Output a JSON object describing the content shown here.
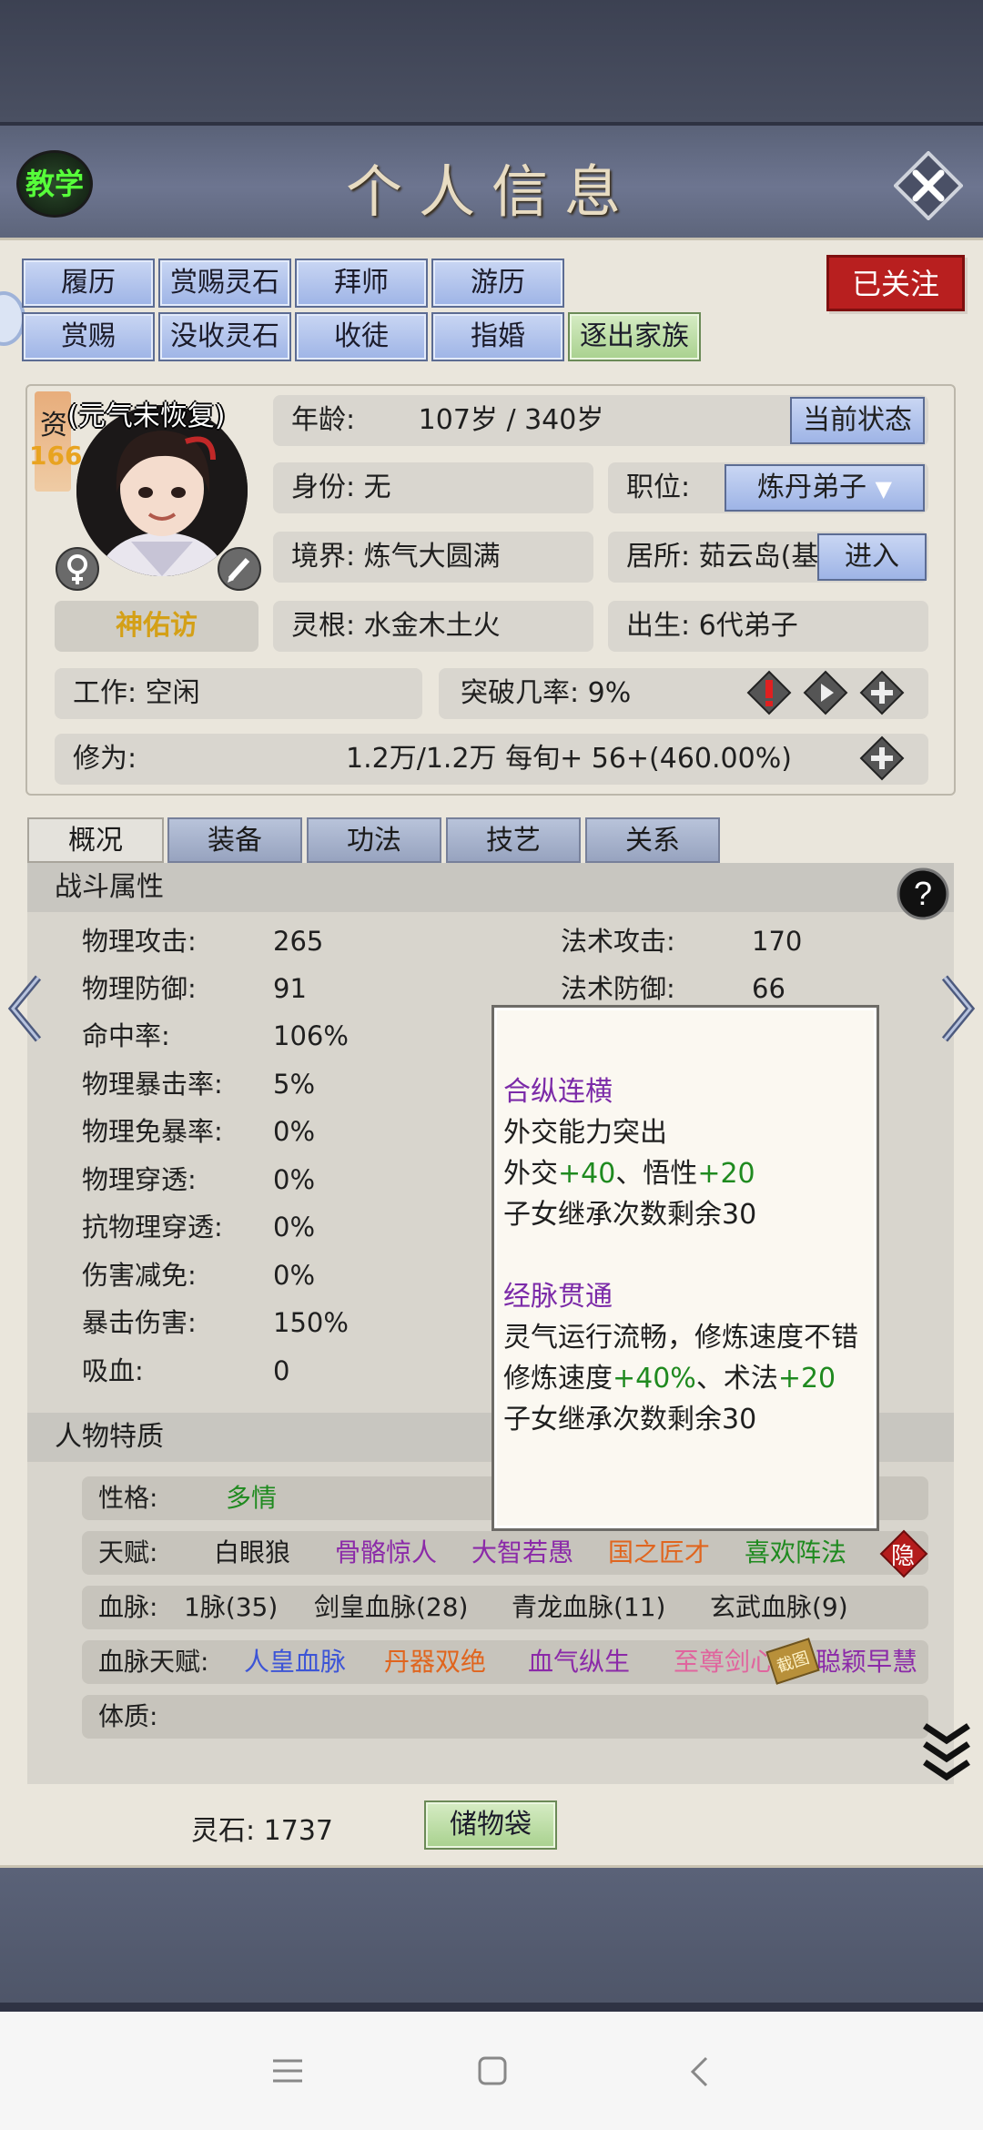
{
  "header": {
    "title": "个人信息",
    "teach_label": "教学"
  },
  "action_rows": [
    [
      "履历",
      "赏赐灵石",
      "拜师",
      "游历"
    ],
    [
      "赏赐",
      "没收灵石",
      "收徒",
      "指婚",
      "逐出家族"
    ]
  ],
  "follow_label": "已关注",
  "profile": {
    "aptitude_label": "资",
    "aptitude_value": "166",
    "status_note": "(元气未恢复)",
    "name": "神佑访",
    "age_label": "年龄:",
    "age_value": "107岁 / 340岁",
    "current_state_btn": "当前状态",
    "identity": "身份:   无",
    "position_label": "职位:",
    "position_value": "炼丹弟子",
    "realm": "境界:   炼气大圆满",
    "residence": "居所: 茹云岛(基",
    "enter_btn": "进入",
    "root": "灵根:   水金木土火",
    "birth": "出生:   6代弟子",
    "work": "工作: 空闲",
    "breakthrough": "突破几率:   9%",
    "cultivation_label": "修为:",
    "cultivation_value": "1.2万/1.2万  每旬+  56+(460.00%)"
  },
  "tabs": [
    "概况",
    "装备",
    "功法",
    "技艺",
    "关系"
  ],
  "combat": {
    "title": "战斗属性",
    "left": [
      {
        "label": "物理攻击:",
        "value": "265"
      },
      {
        "label": "物理防御:",
        "value": "91"
      },
      {
        "label": "命中率:",
        "value": "106%"
      },
      {
        "label": "物理暴击率:",
        "value": "5%"
      },
      {
        "label": "物理免暴率:",
        "value": "0%"
      },
      {
        "label": "物理穿透:",
        "value": "0%"
      },
      {
        "label": "抗物理穿透:",
        "value": "0%"
      },
      {
        "label": "伤害减免:",
        "value": "0%"
      },
      {
        "label": "暴击伤害:",
        "value": "150%"
      },
      {
        "label": "吸血:",
        "value": "0"
      }
    ],
    "right": [
      {
        "label": "法术攻击:",
        "value": "170"
      },
      {
        "label": "法术防御:",
        "value": "66"
      }
    ]
  },
  "traits": {
    "title": "人物特质",
    "personality_label": "性格:",
    "personality_value": "多情",
    "talent_label": "天赋:",
    "talents": [
      {
        "name": "白眼狼",
        "color": "#1f1f1f"
      },
      {
        "name": "骨骼惊人",
        "color": "#8b2aa8"
      },
      {
        "name": "大智若愚",
        "color": "#8b2aa8"
      },
      {
        "name": "国之匠才",
        "color": "#e0651e"
      },
      {
        "name": "喜欢阵法",
        "color": "#1f8a1f"
      }
    ],
    "hide_label": "隐",
    "bloodline_label": "血脉:",
    "bloodlines": [
      "1脉(35)",
      "剑皇血脉(28)",
      "青龙血脉(11)",
      "玄武血脉(9)"
    ],
    "blood_talent_label": "血脉天赋:",
    "blood_talents": [
      {
        "name": "人皇血脉",
        "color": "#3d55d6"
      },
      {
        "name": "丹器双绝",
        "color": "#e0651e"
      },
      {
        "name": "血气纵生",
        "color": "#8b2aa8"
      },
      {
        "name": "至尊剑心",
        "color": "#e0659e"
      },
      {
        "name": "聪颖早慧",
        "color": "#8b2aa8"
      }
    ],
    "stamp_label": "截图",
    "physique_label": "体质:"
  },
  "tooltip": {
    "t1_title": "合纵连横",
    "t1_desc": "外交能力突出",
    "t1_b1": "外交",
    "t1_v1": "+40",
    "t1_sep": "、悟性",
    "t1_v2": "+20",
    "t1_inherit": "子女继承次数剩余30",
    "t2_title": "经脉贯通",
    "t2_desc": "灵气运行流畅，修炼速度不错",
    "t2_b1": "修炼速度",
    "t2_v1": "+40%",
    "t2_sep": "、术法",
    "t2_v2": "+20",
    "t2_inherit": "子女继承次数剩余30"
  },
  "footer": {
    "spirit_stone": "灵石: 1737",
    "bag_btn": "储物袋"
  }
}
